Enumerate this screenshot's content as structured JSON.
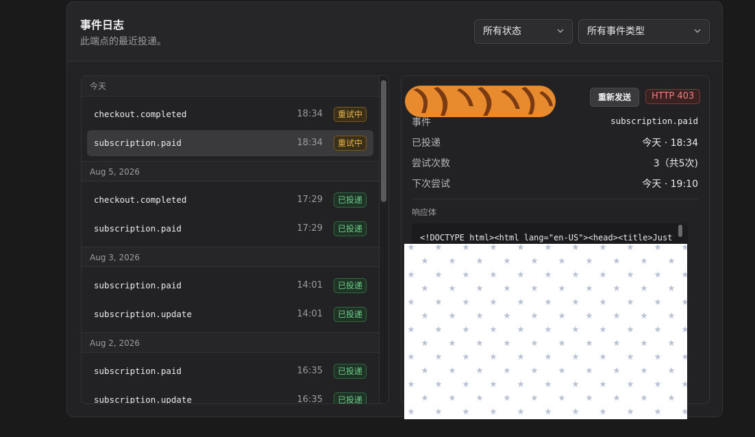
{
  "header": {
    "title": "事件日志",
    "subtitle": "此端点的最近投递。",
    "status_filter": "所有状态",
    "type_filter": "所有事件类型"
  },
  "list": {
    "groups": [
      {
        "label": "今天",
        "rows": [
          {
            "event": "checkout.completed",
            "time": "18:34",
            "status": "重试中"
          },
          {
            "event": "subscription.paid",
            "time": "18:34",
            "status": "重试中"
          }
        ]
      },
      {
        "label": "Aug 5, 2026",
        "rows": [
          {
            "event": "checkout.completed",
            "time": "17:29",
            "status": "已投递"
          },
          {
            "event": "subscription.paid",
            "time": "17:29",
            "status": "已投递"
          }
        ]
      },
      {
        "label": "Aug 3, 2026",
        "rows": [
          {
            "event": "subscription.paid",
            "time": "14:01",
            "status": "已投递"
          },
          {
            "event": "subscription.update",
            "time": "14:01",
            "status": "已投递"
          }
        ]
      },
      {
        "label": "Aug 2, 2026",
        "rows": [
          {
            "event": "subscription.paid",
            "time": "16:35",
            "status": "已投递"
          },
          {
            "event": "subscription.update",
            "time": "16:35",
            "status": "已投递"
          }
        ]
      }
    ]
  },
  "detail": {
    "resend_label": "重新发送",
    "http_status": "HTTP 403",
    "fields": [
      {
        "label": "事件",
        "value": "subscription.paid"
      },
      {
        "label": "已投递",
        "value": "今天 · 18:34"
      },
      {
        "label": "尝试次数",
        "value": "3（共5次)"
      },
      {
        "label": "下次尝试",
        "value": "今天 · 19:10"
      }
    ],
    "response_label": "响应体",
    "response_body": "<!DOCTYPE html><html lang=\"en-US\"><head><title>Just"
  },
  "colors": {
    "retry": "#e9b54a",
    "delivered": "#6dcf8a",
    "error": "#ef7f7f"
  }
}
